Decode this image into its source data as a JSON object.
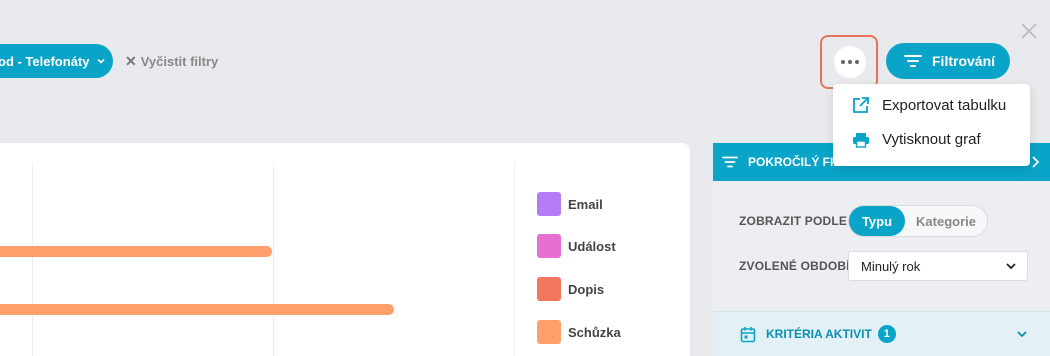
{
  "filters": {
    "active_chip": "od - Telefonáty",
    "clear_label": "Vyčistit filtry",
    "clear_icon": "close-icon"
  },
  "toolbar": {
    "more_icon": "more-horizontal-icon",
    "filter_label": "Filtrování",
    "filter_icon": "filter-icon"
  },
  "menu": {
    "items": [
      {
        "label": "Exportovat tabulku",
        "icon": "external-link-icon"
      },
      {
        "label": "Vytisknout graf",
        "icon": "printer-icon"
      }
    ]
  },
  "chart_data": {
    "type": "bar",
    "legend": [
      {
        "name": "Email",
        "color": "#b57cf6"
      },
      {
        "name": "Událost",
        "color": "#e76fd1"
      },
      {
        "name": "Dopis",
        "color": "#f2775e"
      },
      {
        "name": "Schůzka",
        "color": "#ff9f6b"
      }
    ],
    "bars": [
      {
        "series": "Schůzka",
        "color": "#ff9f6b",
        "relative_length": 0.69
      },
      {
        "series": "Schůzka",
        "color": "#ff9f6b",
        "relative_length": 1.0
      }
    ]
  },
  "panel": {
    "title": "POKROČILÝ FILT",
    "title_icon": "filter-icon",
    "display_by_label": "ZOBRAZIT PODLE",
    "display_options": [
      "Typu",
      "Kategorie"
    ],
    "display_selected": "Typu",
    "period_label": "ZVOLENÉ OBDOBÍ",
    "period_value": "Minulý rok",
    "criteria_label": "KRITÉRIA AKTIVIT",
    "criteria_count": "1",
    "criteria_icon": "calendar-icon"
  },
  "colors": {
    "accent": "#0aa4c8",
    "highlight": "#e5745a"
  }
}
